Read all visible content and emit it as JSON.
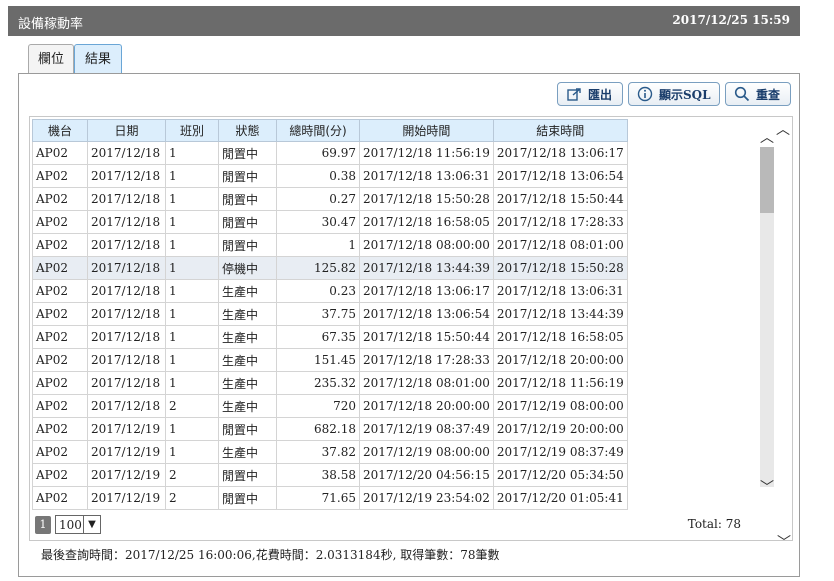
{
  "window": {
    "title": "設備稼動率",
    "datetime": "2017/12/25 15:59"
  },
  "tabs": [
    {
      "label": "欄位"
    },
    {
      "label": "結果"
    }
  ],
  "toolbar": {
    "export_label": "匯出",
    "sql_label": "顯示SQL",
    "query_label": "重查"
  },
  "table": {
    "headers": [
      "機台",
      "日期",
      "班別",
      "狀態",
      "總時間(分)",
      "開始時間",
      "結束時間"
    ],
    "rows": [
      [
        "AP02",
        "2017/12/18",
        "1",
        "閒置中",
        "69.97",
        "2017/12/18 11:56:19",
        "2017/12/18 13:06:17"
      ],
      [
        "AP02",
        "2017/12/18",
        "1",
        "閒置中",
        "0.38",
        "2017/12/18 13:06:31",
        "2017/12/18 13:06:54"
      ],
      [
        "AP02",
        "2017/12/18",
        "1",
        "閒置中",
        "0.27",
        "2017/12/18 15:50:28",
        "2017/12/18 15:50:44"
      ],
      [
        "AP02",
        "2017/12/18",
        "1",
        "閒置中",
        "30.47",
        "2017/12/18 16:58:05",
        "2017/12/18 17:28:33"
      ],
      [
        "AP02",
        "2017/12/18",
        "1",
        "閒置中",
        "1",
        "2017/12/18 08:00:00",
        "2017/12/18 08:01:00"
      ],
      [
        "AP02",
        "2017/12/18",
        "1",
        "停機中",
        "125.82",
        "2017/12/18 13:44:39",
        "2017/12/18 15:50:28"
      ],
      [
        "AP02",
        "2017/12/18",
        "1",
        "生產中",
        "0.23",
        "2017/12/18 13:06:17",
        "2017/12/18 13:06:31"
      ],
      [
        "AP02",
        "2017/12/18",
        "1",
        "生產中",
        "37.75",
        "2017/12/18 13:06:54",
        "2017/12/18 13:44:39"
      ],
      [
        "AP02",
        "2017/12/18",
        "1",
        "生產中",
        "67.35",
        "2017/12/18 15:50:44",
        "2017/12/18 16:58:05"
      ],
      [
        "AP02",
        "2017/12/18",
        "1",
        "生產中",
        "151.45",
        "2017/12/18 17:28:33",
        "2017/12/18 20:00:00"
      ],
      [
        "AP02",
        "2017/12/18",
        "1",
        "生產中",
        "235.32",
        "2017/12/18 08:01:00",
        "2017/12/18 11:56:19"
      ],
      [
        "AP02",
        "2017/12/18",
        "2",
        "生產中",
        "720",
        "2017/12/18 20:00:00",
        "2017/12/19 08:00:00"
      ],
      [
        "AP02",
        "2017/12/19",
        "1",
        "閒置中",
        "682.18",
        "2017/12/19 08:37:49",
        "2017/12/19 20:00:00"
      ],
      [
        "AP02",
        "2017/12/19",
        "1",
        "生產中",
        "37.82",
        "2017/12/19 08:00:00",
        "2017/12/19 08:37:49"
      ],
      [
        "AP02",
        "2017/12/19",
        "2",
        "閒置中",
        "38.58",
        "2017/12/20 04:56:15",
        "2017/12/20 05:34:50"
      ],
      [
        "AP02",
        "2017/12/19",
        "2",
        "閒置中",
        "71.65",
        "2017/12/19 23:54:02",
        "2017/12/20 01:05:41"
      ]
    ],
    "highlight_row": 5
  },
  "pager": {
    "page": "1",
    "page_size": "100",
    "total": "Total: 78"
  },
  "footer": {
    "status": "最後查詢時間：2017/12/25 16:00:06,花費時間：2.0313184秒, 取得筆數：78筆數"
  }
}
